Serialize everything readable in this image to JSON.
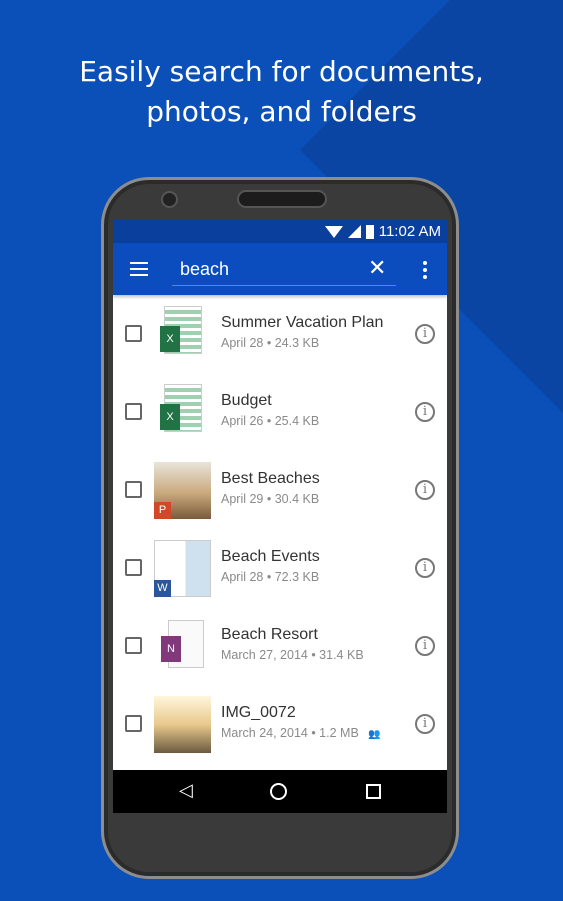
{
  "headline": {
    "line1": "Easily search for documents,",
    "line2": "photos, and folders"
  },
  "status": {
    "time": "11:02 AM"
  },
  "toolbar": {
    "search_value": "beach",
    "clear": "✕"
  },
  "files": [
    {
      "name": "Summer Vacation Plan",
      "meta": "April 28 • 24.3 KB",
      "type": "excel"
    },
    {
      "name": "Budget",
      "meta": "April 26 • 25.4 KB",
      "type": "excel"
    },
    {
      "name": "Best Beaches",
      "meta": "April 29 • 30.4 KB",
      "type": "powerpoint"
    },
    {
      "name": "Beach Events",
      "meta": "April 28 • 72.3 KB",
      "type": "word"
    },
    {
      "name": "Beach Resort",
      "meta": "March 27, 2014 • 31.4 KB",
      "type": "onenote"
    },
    {
      "name": "IMG_0072",
      "meta": "March 24, 2014 • 1.2 MB",
      "type": "photo",
      "shared": true
    }
  ],
  "colors": {
    "brand": "#0b4cbf",
    "excel": "#217346",
    "powerpoint": "#d24726",
    "word": "#2b579a",
    "onenote": "#80397b"
  }
}
